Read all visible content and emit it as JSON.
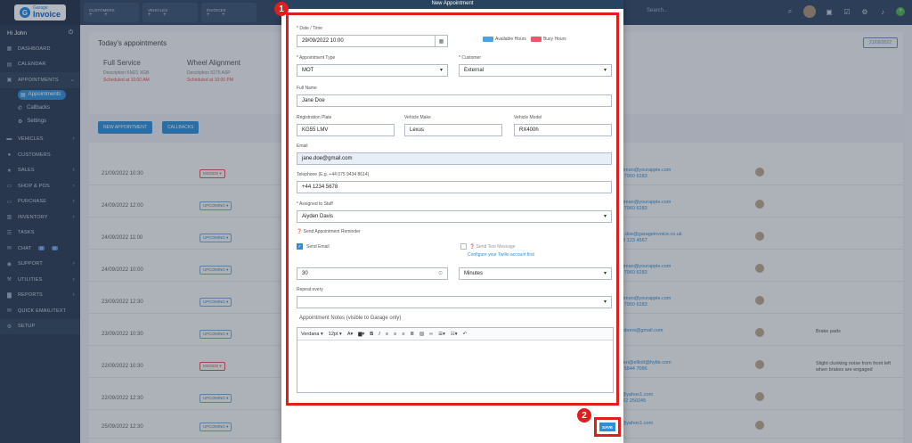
{
  "brand": {
    "line1": "Garage",
    "line2": "Invoice"
  },
  "user": {
    "greeting": "Hi John"
  },
  "sidebar": {
    "items": [
      {
        "label": "DASHBOARD",
        "icon": "dashboard-icon"
      },
      {
        "label": "CALENDAR",
        "icon": "calendar-icon"
      },
      {
        "label": "APPOINTMENTS",
        "icon": "appointments-icon"
      },
      {
        "label": "VEHICLES",
        "icon": "car-icon"
      },
      {
        "label": "CUSTOMERS",
        "icon": "users-icon"
      },
      {
        "label": "SALES",
        "icon": "star-icon"
      },
      {
        "label": "SHOP & POS",
        "icon": "cart-icon"
      },
      {
        "label": "PURCHASE",
        "icon": "purchase-icon"
      },
      {
        "label": "INVENTORY",
        "icon": "inventory-icon"
      },
      {
        "label": "TASKS",
        "icon": "tasks-icon"
      },
      {
        "label": "CHAT",
        "icon": "chat-icon",
        "badges": [
          "0",
          "0"
        ]
      },
      {
        "label": "SUPPORT",
        "icon": "support-icon"
      },
      {
        "label": "UTILITIES",
        "icon": "utilities-icon"
      },
      {
        "label": "REPORTS",
        "icon": "reports-icon"
      },
      {
        "label": "QUICK EMAIL/TEXT",
        "icon": "email-icon"
      },
      {
        "label": "SETUP",
        "icon": "gear-icon"
      }
    ],
    "subitems": [
      {
        "label": "Appointments",
        "icon": "calendar-icon"
      },
      {
        "label": "Callbacks",
        "icon": "phone-icon"
      },
      {
        "label": "Settings",
        "icon": "gear-icon"
      }
    ]
  },
  "topbar": {
    "tabs": [
      "CUSTOMERS",
      "VEHICLES",
      "INVOICES"
    ],
    "search_label": "Search..."
  },
  "background": {
    "title": "Today's appointments",
    "date_button": "21/09/2022",
    "cards": [
      {
        "title": "Full Service",
        "desc": "Description KM21 XGB",
        "sched": "Scheduled at 10:00 AM"
      },
      {
        "title": "Wheel Alignment",
        "desc": "Description 5275 ASP",
        "sched": "Scheduled at 10:00 PM"
      }
    ],
    "buttons": [
      "NEW APPOINTMENT",
      "CALLBACKS"
    ],
    "rows": [
      {
        "date": "21/09/2022 10:30",
        "status": "MISSED",
        "contact": "Newman@yourapple.com",
        "phone": "077 7960 6283",
        "note": ""
      },
      {
        "date": "24/09/2022 12:00",
        "status": "UPCOMING",
        "contact": "Newman@yourapple.com",
        "phone": "077 7960 6283",
        "note": ""
      },
      {
        "date": "24/09/2022 11:00",
        "status": "UPCOMING",
        "contact": "jane.doe@garageinvoice.co.uk",
        "phone": "0798 123 4567",
        "note": ""
      },
      {
        "date": "24/09/2022 10:00",
        "status": "UPCOMING",
        "contact": "Newman@yourapple.com",
        "phone": "077 7960 6283",
        "note": ""
      },
      {
        "date": "23/09/2022 12:30",
        "status": "UPCOMING",
        "contact": "Newman@yourapple.com",
        "phone": "077 7960 6283",
        "note": ""
      },
      {
        "date": "23/09/2022 10:30",
        "status": "UPCOMING",
        "contact": "mgibbons@gmail.com",
        "phone": "",
        "note": "Brake pads"
      },
      {
        "date": "22/09/2022 10:30",
        "status": "MISSED",
        "contact": "Hyden@elliott@hytte.com",
        "phone": "078 5844 7086",
        "note": "Slight clunking noise from front left when brakes are engaged"
      },
      {
        "date": "22/09/2022 12:30",
        "status": "UPCOMING",
        "contact": "ray@yahoo1.com",
        "phone": "01322 250245",
        "note": ""
      },
      {
        "date": "25/09/2022 12:30",
        "status": "UPCOMING",
        "contact": "ray@yahoo1.com",
        "phone": "",
        "note": ""
      }
    ]
  },
  "modal": {
    "title": "New Appointment",
    "date_time": {
      "label": "* Date / Time",
      "value": "29/09/2022 10:00"
    },
    "legend": {
      "available": "Available Hours",
      "busy": "Busy Hours",
      "available_color": "#4aa3e0",
      "busy_color": "#e85a6a"
    },
    "appointment_type": {
      "label": "* Appointment Type",
      "value": "MOT"
    },
    "customer": {
      "label": "* Customer",
      "value": "External"
    },
    "full_name": {
      "label": "Full Name",
      "value": "Jane Doe"
    },
    "reg_plate": {
      "label": "Registration Plate",
      "value": "KG55 LMV"
    },
    "make": {
      "label": "Vehicle Make",
      "value": "Lexus"
    },
    "model": {
      "label": "Vehicle Model",
      "value": "RX400h"
    },
    "email": {
      "label": "Email",
      "value": "jane.doe@gmail.com"
    },
    "telephone": {
      "label": "Telephone (E.g. +44 075 9434 8614)",
      "value": "+44 1234 5678"
    },
    "staff": {
      "label": "* Assigned to Staff",
      "value": "Aiyden Davis"
    },
    "reminder_label": "Send Appointment Reminder",
    "send_email": "Send Email",
    "send_text": "Send Text Message",
    "twilio_link": "Configure your Twilio account first",
    "reminder_amount": "30",
    "reminder_unit": "Minutes",
    "repeat_label": "Repeat every",
    "notes_label": "Appointment Notes (visible to Garage only)",
    "editor": {
      "font": "Verdana",
      "size": "12pt"
    },
    "save_label": "SAVE"
  },
  "callouts": [
    "1",
    "2"
  ],
  "accent": "#2d8fd8",
  "highlight": "#e01e1e"
}
